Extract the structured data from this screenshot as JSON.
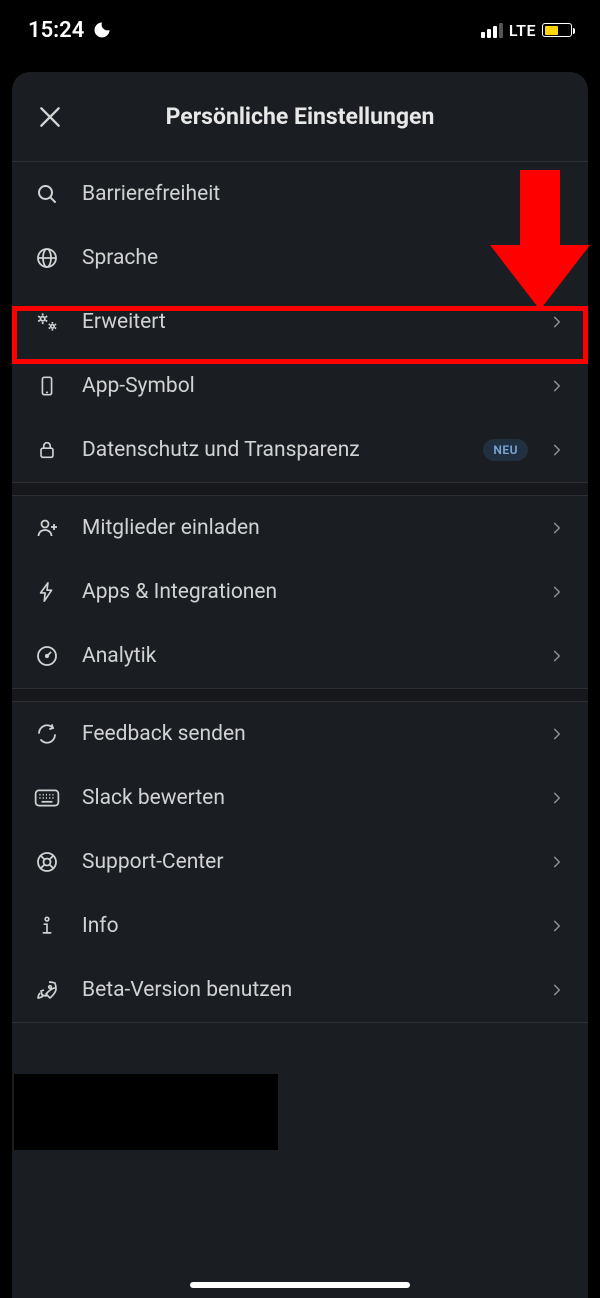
{
  "status": {
    "time": "15:24",
    "network": "LTE"
  },
  "header": {
    "title": "Persönliche Einstellungen"
  },
  "rows": {
    "accessibility": "Barrierefreiheit",
    "language": "Sprache",
    "advanced": "Erweitert",
    "appicon": "App-Symbol",
    "privacy": "Datenschutz und Transparenz",
    "privacy_badge": "NEU",
    "invite": "Mitglieder einladen",
    "apps": "Apps & Integrationen",
    "analytics": "Analytik",
    "feedback": "Feedback senden",
    "rate": "Slack bewerten",
    "support": "Support-Center",
    "info": "Info",
    "beta": "Beta-Version benutzen"
  }
}
